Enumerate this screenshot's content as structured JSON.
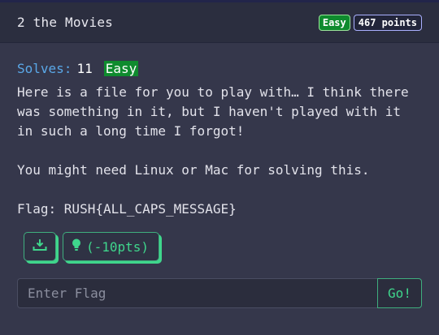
{
  "challenge": {
    "title": "2 the Movies",
    "difficulty_badge": "Easy",
    "points_badge": "467 points",
    "solves_label": "Solves:",
    "solves_count": "11",
    "difficulty_tag": "Easy",
    "description": "Here is a file for you to play with… I think there\nwas something in it, but I haven't played with it\nin such a long time I forgot!\n\nYou might need Linux or Mac for solving this.\n\nFlag: RUSH{ALL_CAPS_MESSAGE}",
    "hint_label": "(-10pts)"
  },
  "flag_form": {
    "placeholder": "Enter Flag",
    "submit_label": "Go!"
  },
  "colors": {
    "accent_green": "#3fd68c",
    "badge_green": "#0f8b2e",
    "solves_blue": "#5aa8e8",
    "card_bg": "#35374b"
  },
  "icons": {
    "download": "download-icon",
    "hint": "lightbulb-icon"
  }
}
